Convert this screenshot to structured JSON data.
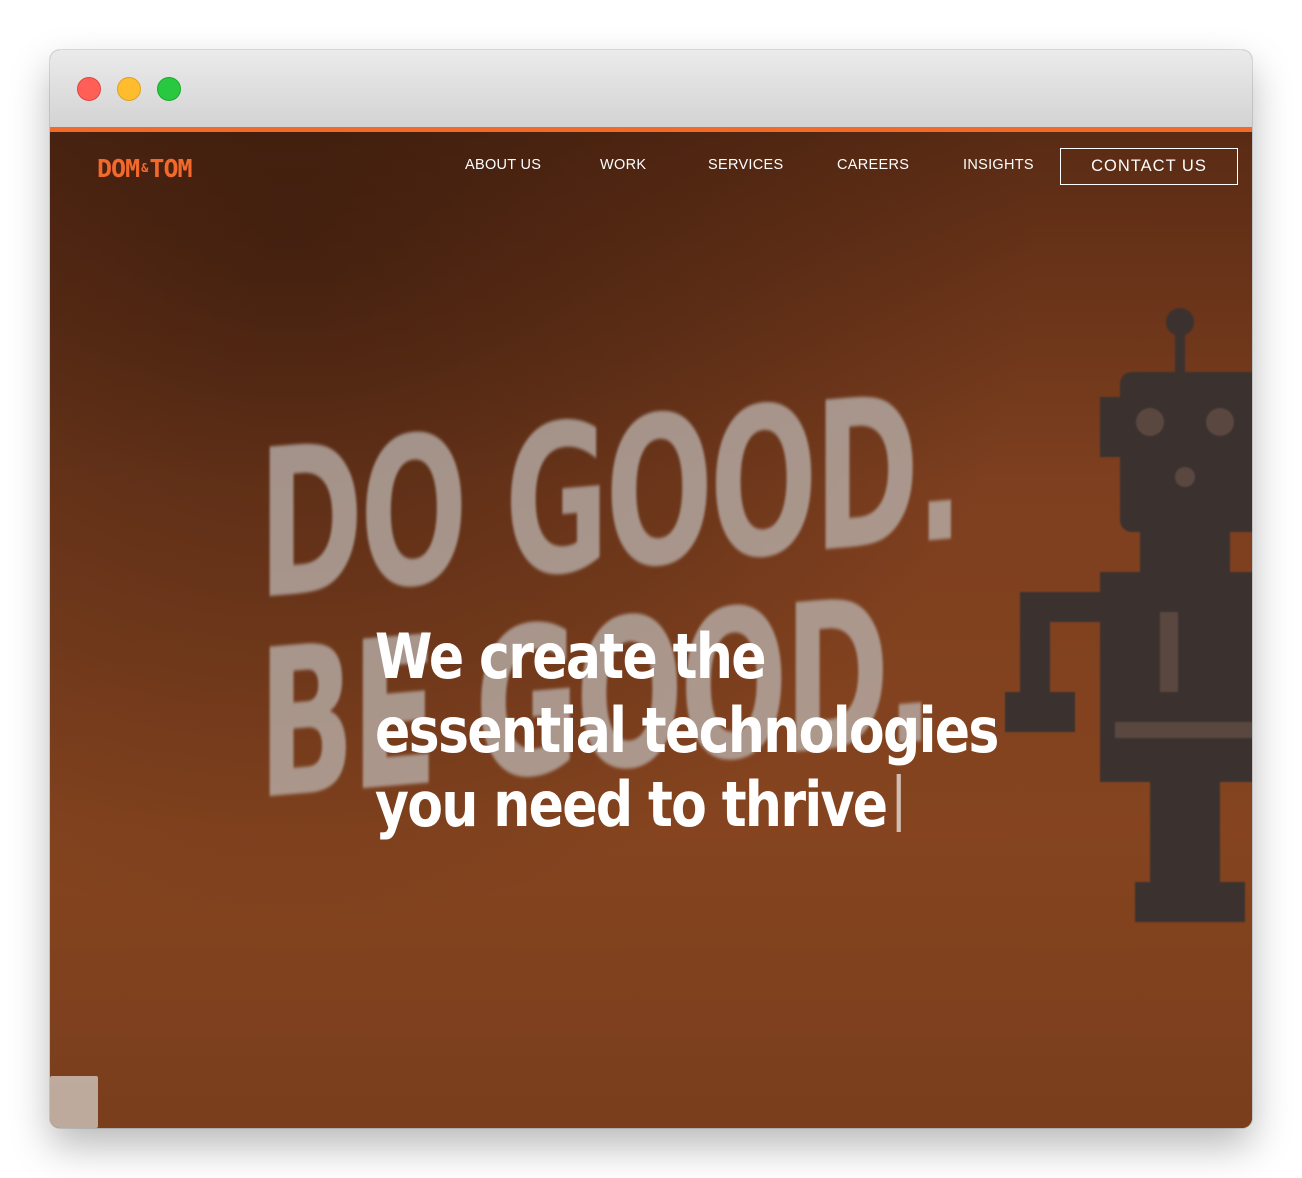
{
  "brand": {
    "logo_left": "DOM",
    "logo_amp": "&",
    "logo_right": "TOM",
    "accent_color": "#f26a2a"
  },
  "nav": {
    "items": [
      {
        "label": "ABOUT US"
      },
      {
        "label": "WORK"
      },
      {
        "label": "SERVICES"
      },
      {
        "label": "CAREERS"
      },
      {
        "label": "INSIGHTS"
      }
    ],
    "cta_label": "CONTACT US"
  },
  "hero": {
    "headline_lines": [
      "We create the",
      "essential technologies",
      "you need to thrive"
    ],
    "wall_lines": [
      "DO GOOD.",
      "BE GOOD."
    ]
  },
  "window": {
    "controls": [
      "close-icon",
      "minimize-icon",
      "maximize-icon"
    ]
  }
}
